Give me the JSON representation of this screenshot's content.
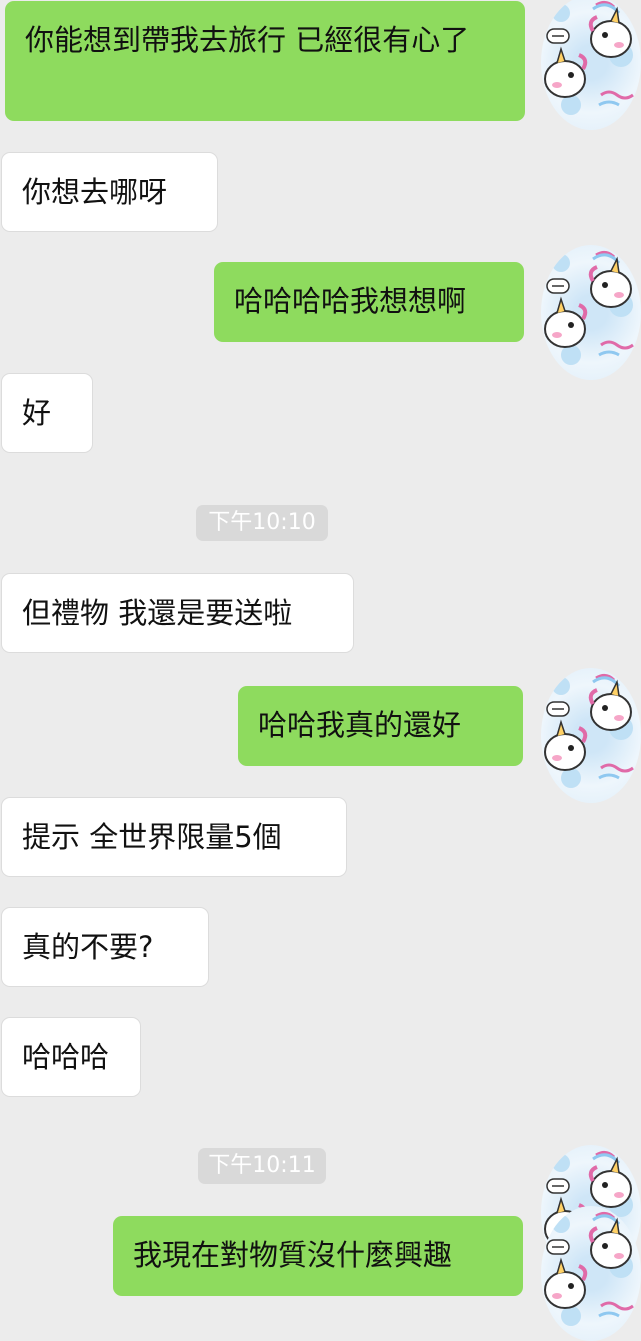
{
  "conversation": {
    "messages": [
      {
        "kind": "out",
        "text": "你能想到帶我去旅行 已經很有心了"
      },
      {
        "kind": "in",
        "text": "你想去哪呀"
      },
      {
        "kind": "out",
        "text": "哈哈哈哈我想想啊"
      },
      {
        "kind": "in",
        "text": "好"
      },
      {
        "kind": "time",
        "text": "下午10:10"
      },
      {
        "kind": "in",
        "text": "但禮物 我還是要送啦"
      },
      {
        "kind": "out",
        "text": "哈哈我真的還好"
      },
      {
        "kind": "in",
        "text": "提示 全世界限量5個"
      },
      {
        "kind": "in",
        "text": "真的不要?"
      },
      {
        "kind": "in",
        "text": "哈哈哈"
      },
      {
        "kind": "time",
        "text": "下午10:11"
      },
      {
        "kind": "out",
        "text": "我現在對物質沒什麼興趣"
      }
    ]
  },
  "avatar_icon": "unicorn-pattern-avatar-icon",
  "colors": {
    "background": "#ececec",
    "outgoing_bubble": "#8edb5e",
    "incoming_bubble": "#ffffff",
    "timestamp_bg": "#d9d9d9"
  }
}
